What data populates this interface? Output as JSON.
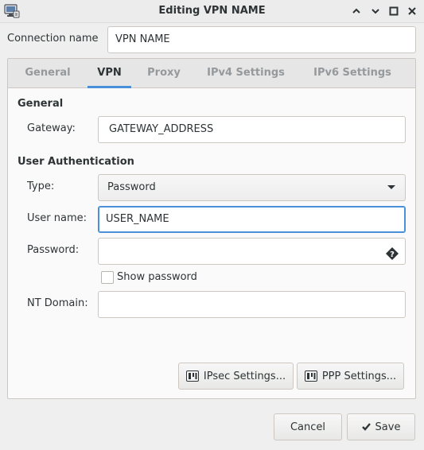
{
  "window": {
    "title": "Editing VPN NAME",
    "controls": [
      "minimize",
      "maximize",
      "restore",
      "close"
    ]
  },
  "connection": {
    "label": "Connection name",
    "value": "VPN NAME"
  },
  "tabs": [
    {
      "label": "General",
      "active": false
    },
    {
      "label": "VPN",
      "active": true
    },
    {
      "label": "Proxy",
      "active": false
    },
    {
      "label": "IPv4 Settings",
      "active": false
    },
    {
      "label": "IPv6 Settings",
      "active": false
    }
  ],
  "vpn": {
    "general_heading": "General",
    "gateway_label": "Gateway:",
    "gateway_value": "GATEWAY_ADDRESS",
    "auth_heading": "User Authentication",
    "type_label": "Type:",
    "type_value": "Password",
    "username_label": "User name:",
    "username_value": "USER_NAME",
    "password_label": "Password:",
    "password_value": "",
    "show_password_label": "Show password",
    "show_password_checked": false,
    "ntdomain_label": "NT Domain:",
    "ntdomain_value": "",
    "ipsec_button": "IPsec Settings...",
    "ppp_button": "PPP Settings..."
  },
  "footer": {
    "cancel": "Cancel",
    "save": "Save"
  },
  "colors": {
    "accent": "#4a90d9",
    "background": "#efefef"
  }
}
